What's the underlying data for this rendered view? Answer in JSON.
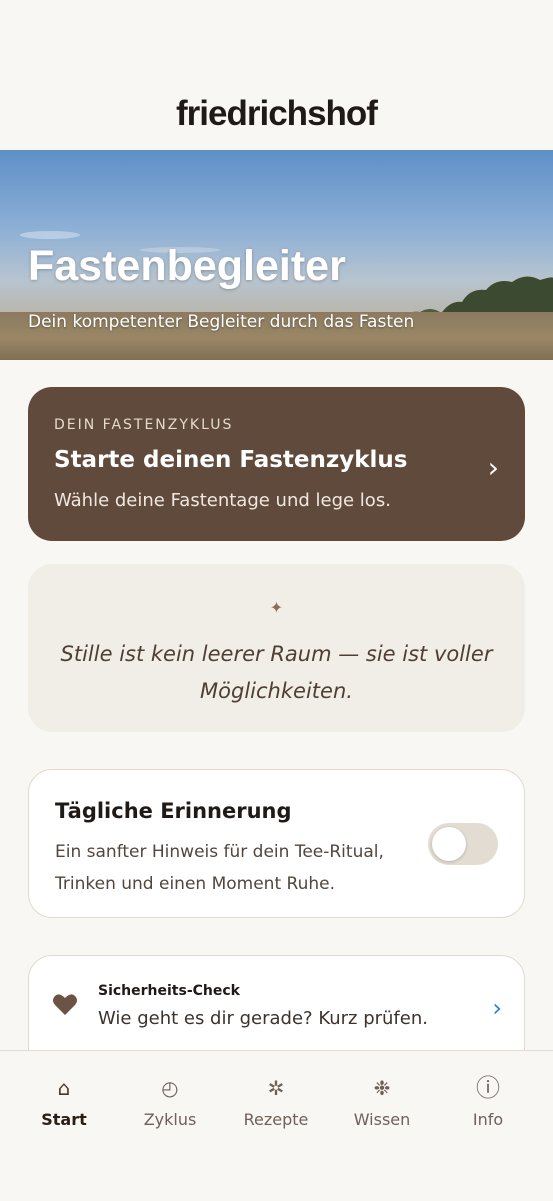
{
  "header": {
    "logo": "friedrichshof"
  },
  "hero": {
    "title": "Fastenbegleiter",
    "subtitle": "Dein kompetenter Begleiter durch das Fasten"
  },
  "cycle_card": {
    "eyebrow": "DEIN FASTENZYKLUS",
    "title": "Starte deinen Fastenzyklus",
    "subtitle": "Wähle deine Fastentage und lege los.",
    "chevron": "›"
  },
  "quote_card": {
    "star": "✦",
    "text": "Stille ist kein leerer Raum — sie ist voller Möglichkeiten."
  },
  "reminder_card": {
    "title": "Tägliche Erinnerung",
    "subtitle": "Ein sanfter Hinweis für dein Tee-Ritual, Trinken und einen Moment Ruhe.",
    "toggle_on": false
  },
  "safety_card": {
    "title": "Sicherheits-Check",
    "subtitle": "Wie geht es dir gerade? Kurz prüfen.",
    "chevron": "›",
    "icon": "heart-icon"
  },
  "tabs": [
    {
      "label": "Start",
      "icon": "home-icon",
      "glyph": "⌂",
      "active": true
    },
    {
      "label": "Zyklus",
      "icon": "clock-icon",
      "glyph": "◴",
      "active": false
    },
    {
      "label": "Rezepte",
      "icon": "asterisk-icon",
      "glyph": "✲",
      "active": false
    },
    {
      "label": "Wissen",
      "icon": "snowflake-icon",
      "glyph": "❉",
      "active": false
    },
    {
      "label": "Info",
      "icon": "info-icon",
      "glyph": "ⓘ",
      "active": false
    }
  ],
  "colors": {
    "background": "#f9f7f3",
    "cycle_card": "#5f4a3b",
    "quote_card": "#f1ede7",
    "accent_blue": "#2a7de1",
    "heart": "#6b5444"
  }
}
